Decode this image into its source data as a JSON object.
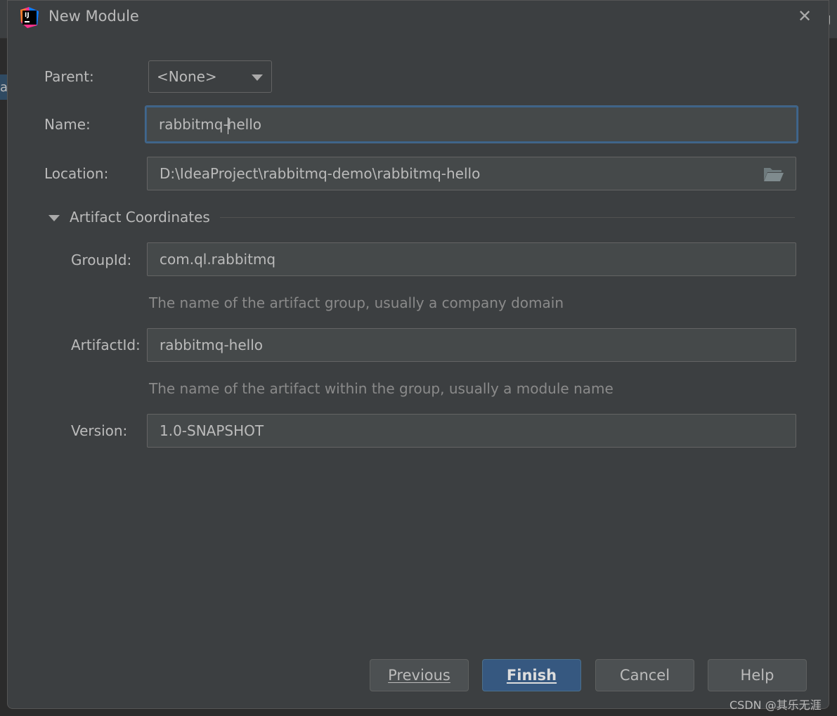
{
  "window": {
    "title": "New Module",
    "close_icon": "close-icon",
    "logo": "IJ"
  },
  "form": {
    "parent": {
      "label": "Parent:",
      "value": "<None>"
    },
    "name": {
      "label": "Name:",
      "value_before_cursor": "rabbitmq-",
      "value_after_cursor": "hello"
    },
    "location": {
      "label": "Location:",
      "value": "D:\\IdeaProject\\rabbitmq-demo\\rabbitmq-hello",
      "icon": "folder-icon"
    },
    "section": {
      "label": "Artifact Coordinates",
      "expanded": true
    },
    "group_id": {
      "label": "GroupId:",
      "value": "com.ql.rabbitmq",
      "hint": "The name of the artifact group, usually a company domain"
    },
    "artifact_id": {
      "label": "ArtifactId:",
      "value": "rabbitmq-hello",
      "hint": "The name of the artifact within the group, usually a module name"
    },
    "version": {
      "label": "Version:",
      "value": "1.0-SNAPSHOT"
    }
  },
  "buttons": {
    "previous": "Previous",
    "finish": "Finish",
    "cancel": "Cancel",
    "help": "Help"
  },
  "watermark": "CSDN @其乐无涯",
  "colors": {
    "dialog_bg": "#3c3f41",
    "field_bg": "#45494a",
    "primary": "#365880",
    "focus": "#3d6185"
  }
}
